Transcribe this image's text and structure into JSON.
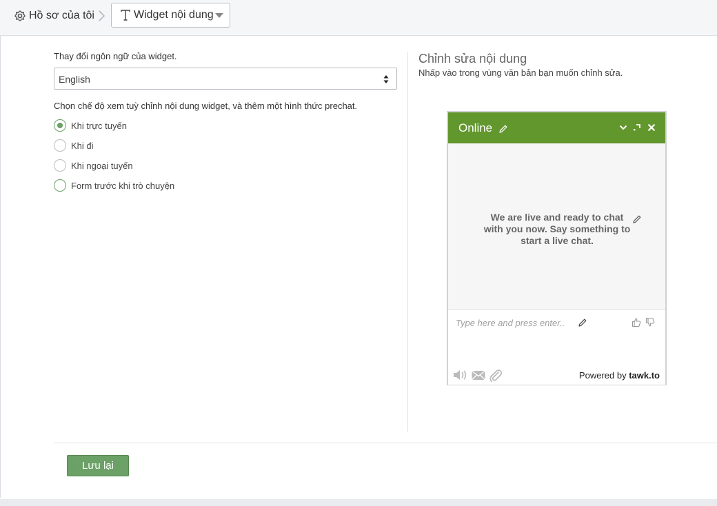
{
  "breadcrumb": {
    "home_label": "Hồ sơ của tôi",
    "section_label": "Widget nội dung",
    "home_icon": "gear-icon",
    "section_icon": "text-t-icon"
  },
  "left": {
    "language_label": "Thay đổi ngôn ngữ của widget.",
    "language_value": "English",
    "mode_label": "Chọn chế độ xem tuỳ chỉnh nội dung widget, và thêm một hình thức prechat.",
    "modes": [
      {
        "label": "Khi trực tuyến",
        "checked": true
      },
      {
        "label": "Khi đi",
        "checked": false
      },
      {
        "label": "Khi ngoại tuyến",
        "checked": false
      },
      {
        "label": "Form trước khi trò chuyện",
        "checked": false
      }
    ]
  },
  "right": {
    "title": "Chỉnh sửa nội dung",
    "subtitle": "Nhấp vào trong vùng văn bản bạn muốn chỉnh sửa."
  },
  "widget": {
    "status": "Online",
    "message": "We are live and ready to chat with you now. Say something to start a live chat.",
    "input_placeholder": "Type here and press enter..",
    "powered_prefix": "Powered by",
    "powered_brand": "tawk.to",
    "header_color": "#62972d"
  },
  "actions": {
    "save_label": "Lưu lại",
    "save_color": "#6ba166"
  }
}
